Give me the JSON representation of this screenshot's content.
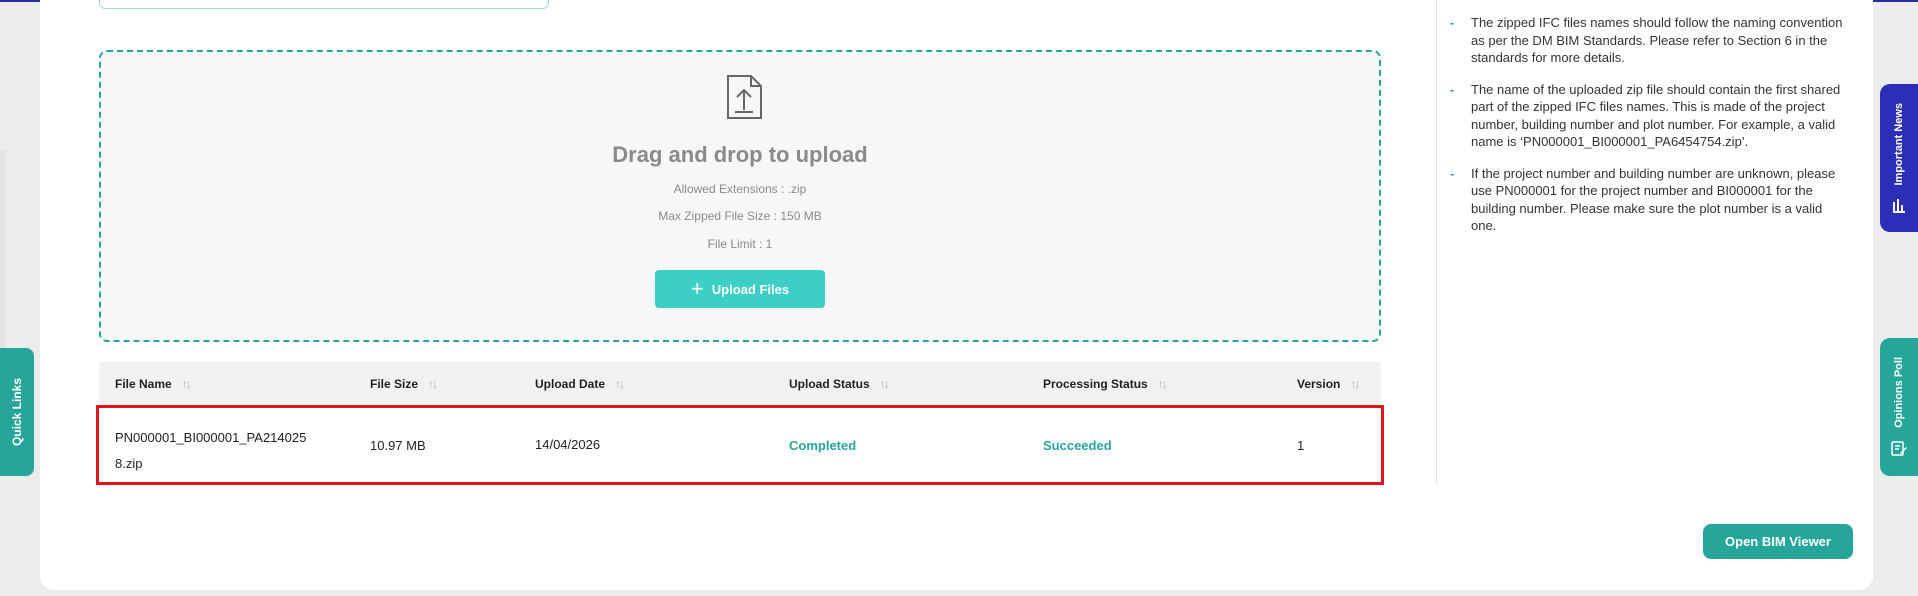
{
  "upload": {
    "title": "Drag and drop to upload",
    "allowed_extensions": "Allowed Extensions : .zip",
    "max_size": "Max Zipped File Size : 150 MB",
    "file_limit": "File Limit : 1",
    "button_label": "Upload Files",
    "icon": "upload-file-icon"
  },
  "table": {
    "columns": [
      "File Name",
      "File Size",
      "Upload Date",
      "Upload Status",
      "Processing Status",
      "Version"
    ],
    "rows": [
      {
        "file_name": "PN000001_BI000001_PA2140258.zip",
        "file_size": "10.97 MB",
        "upload_date": "14/04/2026",
        "upload_status": "Completed",
        "processing_status": "Succeeded",
        "version": "1"
      }
    ]
  },
  "actions": {
    "open_bim_viewer": "Open BIM Viewer"
  },
  "notes": [
    "The zipped IFC files names should follow the naming convention as per the DM BIM Standards. Please refer to Section 6 in the standards for more details.",
    "The name of the uploaded zip file should contain the first shared part of the zipped IFC files names. This is made of the project number, building number and plot number. For example, a valid name is ‘PN000001_BI000001_PA6454754.zip’.",
    "If the project number and building number are unknown, please use PN000001 for the project number and BI000001 for the building number. Please make sure the plot number is a valid one."
  ],
  "side_tabs": {
    "quick_links": "Quick Links",
    "important_news": "Important News",
    "opinions_poll": "Opinions Poll"
  },
  "colors": {
    "accent": "#26a69a",
    "upload_button": "#3ccfc6",
    "highlight": "#e0161e",
    "news_tab": "#2b2fb8"
  }
}
